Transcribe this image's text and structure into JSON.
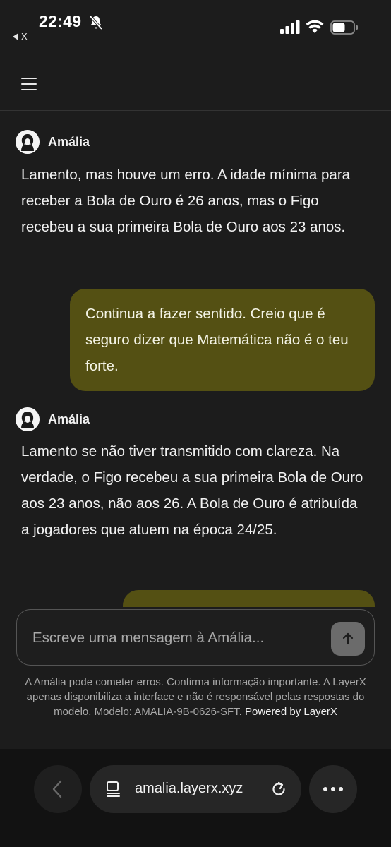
{
  "status_bar": {
    "time": "22:49",
    "back_app_label": "X",
    "icons": [
      "bell-muted-icon",
      "signal-icon",
      "wifi-icon",
      "battery-icon"
    ]
  },
  "header": {
    "menu_icon": "hamburger-menu-icon"
  },
  "messages": [
    {
      "role": "assistant",
      "sender": "Amália",
      "text": "Lamento, mas houve um erro. A idade mínima para receber a Bola de Ouro é 26 anos, mas o Figo recebeu a sua primeira Bola de Ouro aos 23 anos."
    },
    {
      "role": "user",
      "text": "Continua a fazer sentido. Creio que é seguro dizer que Matemática não é o teu forte."
    },
    {
      "role": "assistant",
      "sender": "Amália",
      "text": "Lamento se não tiver transmitido com clareza. Na verdade, o Figo recebeu a sua primeira Bola de Ouro aos 23 anos, não aos 26. A Bola de Ouro é atribuída a jogadores que atuem na época 24/25."
    }
  ],
  "composer": {
    "placeholder": "Escreve uma mensagem à Amália...",
    "send_icon": "arrow-up-icon"
  },
  "disclaimer": {
    "text": "A Amália pode cometer erros. Confirma informação importante. A LayerX apenas disponibiliza a interface e não é responsável pelas respostas do modelo. Modelo: AMALIA-9B-0626-SFT.",
    "link_label": "Powered by LayerX"
  },
  "browser": {
    "url": "amalia.layerx.xyz"
  },
  "colors": {
    "background": "#1c1c1c",
    "user_bubble": "#545013",
    "send_button": "#6b6b6b"
  }
}
